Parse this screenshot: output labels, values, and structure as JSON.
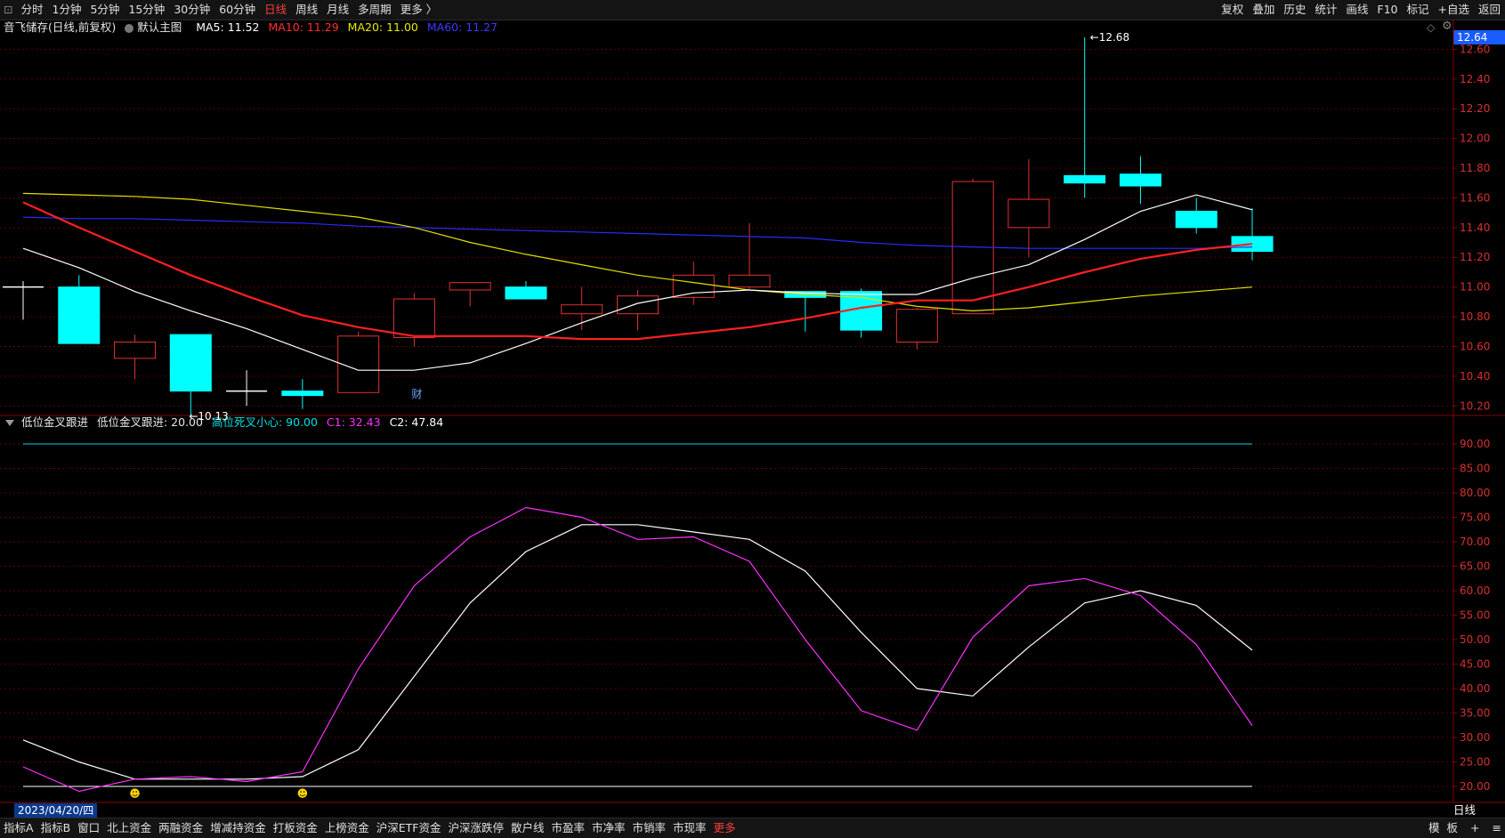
{
  "toolbar": {
    "periods": [
      "分时",
      "1分钟",
      "5分钟",
      "15分钟",
      "30分钟",
      "60分钟",
      "日线",
      "周线",
      "月线",
      "多周期",
      "更多 〉"
    ],
    "active_period": "日线",
    "right_buttons": [
      "复权",
      "叠加",
      "历史",
      "统计",
      "画线",
      "F10",
      "标记",
      "+自选",
      "返回"
    ]
  },
  "main_legend": {
    "stock": "音飞储存(日线,前复权)",
    "template": "默认主图",
    "ma5": "MA5: 11.52",
    "ma10": "MA10: 11.29",
    "ma20": "MA20: 11.00",
    "ma60": "MA60: 11.27"
  },
  "indicator_legend": {
    "name": "低位金叉跟进",
    "l1": "低位金叉跟进: 20.00",
    "l2": "高位死叉小心: 90.00",
    "c1": "C1: 32.43",
    "c2": "C2: 47.84"
  },
  "current_price": "12.64",
  "high_label": "12.68",
  "low_label": "10.13",
  "fin_marker": "财",
  "date_label": "2023/04/20/四",
  "period_label": "日线",
  "bottom_tabs": [
    "指标A",
    "指标B",
    "窗口",
    "北上资金",
    "两融资金",
    "增减持资金",
    "打板资金",
    "上榜资金",
    "沪深ETF资金",
    "沪深涨跌停",
    "散户线",
    "市盈率",
    "市净率",
    "市销率",
    "市现率",
    "更多"
  ],
  "bottom_right": [
    "模",
    "板",
    "+",
    "≡"
  ],
  "colors": {
    "up": "#e03232",
    "down": "#00ffff",
    "ma5": "#ffffff",
    "ma10": "#ff2020",
    "ma20": "#e0e000",
    "ma60": "#2a2aff",
    "c1": "#ff30ff",
    "c2": "#ffffff",
    "grid": "#5a0000"
  },
  "chart_data": [
    {
      "type": "candlestick",
      "ylim": [
        10.13,
        12.68
      ],
      "y_ticks": [
        10.2,
        10.4,
        10.6,
        10.8,
        11.0,
        11.2,
        11.4,
        11.6,
        11.8,
        12.0,
        12.2,
        12.4,
        12.6
      ],
      "candles": [
        {
          "o": 11.0,
          "h": 11.04,
          "l": 10.78,
          "c": 11.0
        },
        {
          "o": 11.0,
          "h": 11.08,
          "l": 10.62,
          "c": 10.62
        },
        {
          "o": 10.52,
          "h": 10.68,
          "l": 10.38,
          "c": 10.63
        },
        {
          "o": 10.68,
          "h": 10.68,
          "l": 10.13,
          "c": 10.3
        },
        {
          "o": 10.3,
          "h": 10.44,
          "l": 10.2,
          "c": 10.3
        },
        {
          "o": 10.3,
          "h": 10.38,
          "l": 10.18,
          "c": 10.27
        },
        {
          "o": 10.29,
          "h": 10.7,
          "l": 10.29,
          "c": 10.67
        },
        {
          "o": 10.66,
          "h": 10.96,
          "l": 10.6,
          "c": 10.92
        },
        {
          "o": 10.98,
          "h": 11.03,
          "l": 10.87,
          "c": 11.03
        },
        {
          "o": 11.0,
          "h": 11.04,
          "l": 10.92,
          "c": 10.92
        },
        {
          "o": 10.82,
          "h": 11.0,
          "l": 10.71,
          "c": 10.88
        },
        {
          "o": 10.82,
          "h": 10.98,
          "l": 10.71,
          "c": 10.94
        },
        {
          "o": 10.93,
          "h": 11.17,
          "l": 10.88,
          "c": 11.08
        },
        {
          "o": 11.0,
          "h": 11.43,
          "l": 10.98,
          "c": 11.08
        },
        {
          "o": 10.97,
          "h": 10.97,
          "l": 10.7,
          "c": 10.93
        },
        {
          "o": 10.97,
          "h": 10.99,
          "l": 10.66,
          "c": 10.71
        },
        {
          "o": 10.63,
          "h": 10.86,
          "l": 10.58,
          "c": 10.85
        },
        {
          "o": 10.82,
          "h": 11.73,
          "l": 10.82,
          "c": 11.71
        },
        {
          "o": 11.4,
          "h": 11.86,
          "l": 11.2,
          "c": 11.59
        },
        {
          "o": 11.75,
          "h": 12.68,
          "l": 11.6,
          "c": 11.7
        },
        {
          "o": 11.76,
          "h": 11.88,
          "l": 11.56,
          "c": 11.68
        },
        {
          "o": 11.51,
          "h": 11.6,
          "l": 11.36,
          "c": 11.4
        },
        {
          "o": 11.34,
          "h": 11.53,
          "l": 11.18,
          "c": 11.24
        }
      ],
      "ma5": [
        11.26,
        11.13,
        10.97,
        10.84,
        10.72,
        10.58,
        10.44,
        10.44,
        10.49,
        10.62,
        10.76,
        10.89,
        10.96,
        10.98,
        10.96,
        10.95,
        10.95,
        11.06,
        11.15,
        11.32,
        11.51,
        11.62,
        11.52
      ],
      "ma10": [
        11.57,
        11.4,
        11.24,
        11.08,
        10.94,
        10.81,
        10.73,
        10.67,
        10.67,
        10.67,
        10.65,
        10.65,
        10.69,
        10.73,
        10.79,
        10.86,
        10.91,
        10.91,
        11.0,
        11.1,
        11.19,
        11.25,
        11.29
      ],
      "ma20": [
        11.63,
        11.62,
        11.61,
        11.59,
        11.55,
        11.51,
        11.47,
        11.4,
        11.3,
        11.22,
        11.15,
        11.08,
        11.03,
        10.98,
        10.95,
        10.93,
        10.87,
        10.84,
        10.86,
        10.9,
        10.94,
        10.97,
        11.0
      ],
      "ma60": [
        11.47,
        11.46,
        11.46,
        11.45,
        11.44,
        11.43,
        11.41,
        11.4,
        11.39,
        11.38,
        11.37,
        11.36,
        11.35,
        11.34,
        11.33,
        11.3,
        11.28,
        11.27,
        11.26,
        11.26,
        11.26,
        11.26,
        11.27
      ]
    },
    {
      "type": "line",
      "title": "低位金叉跟进",
      "ylim": [
        18,
        92
      ],
      "y_ticks": [
        20.0,
        25.0,
        30.0,
        35.0,
        40.0,
        45.0,
        50.0,
        55.0,
        60.0,
        65.0,
        70.0,
        75.0,
        80.0,
        85.0,
        90.0
      ],
      "series": [
        {
          "name": "C1",
          "values": [
            24.0,
            19.0,
            21.5,
            22.0,
            21.0,
            23.0,
            44.0,
            61.0,
            71.0,
            77.0,
            75.0,
            70.5,
            71.0,
            66.0,
            50.0,
            35.5,
            31.5,
            50.5,
            61.0,
            62.5,
            59.0,
            49.0,
            32.43
          ]
        },
        {
          "name": "C2",
          "values": [
            29.5,
            25.0,
            21.5,
            21.5,
            21.5,
            22.0,
            27.5,
            42.5,
            57.5,
            68.0,
            73.5,
            73.5,
            72.0,
            70.5,
            64.0,
            51.5,
            40.0,
            38.5,
            48.5,
            57.5,
            60.0,
            57.0,
            47.84
          ]
        }
      ],
      "thresholds": [
        20.0,
        90.0
      ],
      "signal_bars": [
        2,
        5
      ]
    }
  ]
}
